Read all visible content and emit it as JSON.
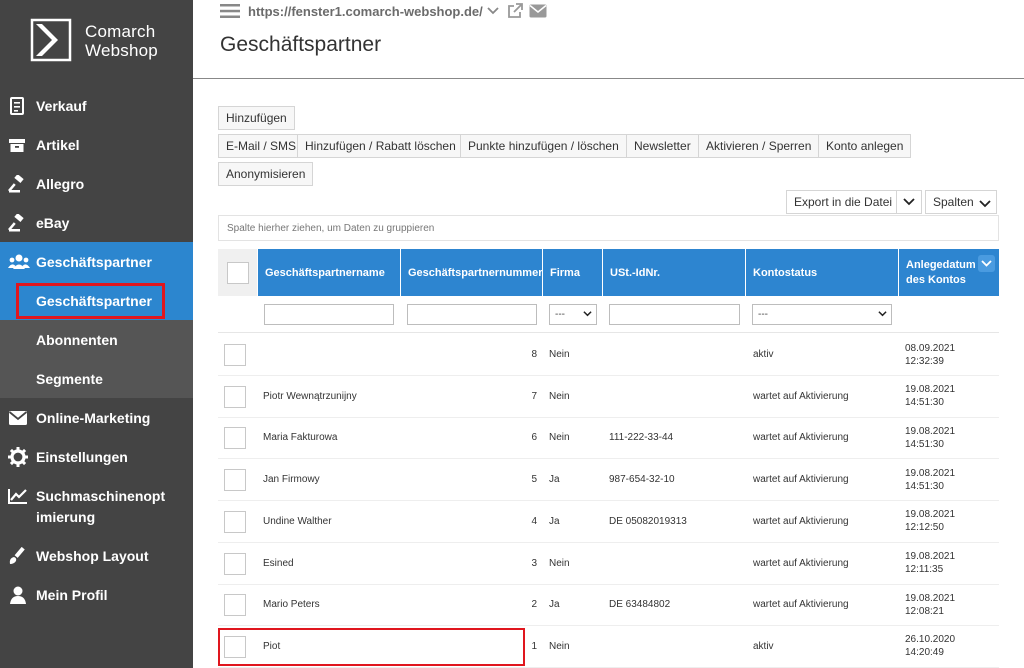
{
  "logo": {
    "line1": "Comarch",
    "line2": "Webshop"
  },
  "sidebar": {
    "items": [
      {
        "label": "Verkauf",
        "icon": "document-icon"
      },
      {
        "label": "Artikel",
        "icon": "box-icon"
      },
      {
        "label": "Allegro",
        "icon": "gavel-icon"
      },
      {
        "label": "eBay",
        "icon": "gavel-icon"
      },
      {
        "label": "Geschäftspartner",
        "icon": "users-icon"
      },
      {
        "label": "Online-Marketing",
        "icon": "envelope-icon"
      },
      {
        "label": "Einstellungen",
        "icon": "gear-icon"
      },
      {
        "label": "Suchmaschinenopt imierung",
        "line1": "Suchmaschinenopt",
        "line2": "imierung",
        "icon": "chart-icon"
      },
      {
        "label": "Webshop Layout",
        "icon": "brush-icon"
      },
      {
        "label": "Mein Profil",
        "icon": "user-icon"
      }
    ],
    "subitems": [
      {
        "label": "Geschäftspartner"
      },
      {
        "label": "Abonnenten"
      },
      {
        "label": "Segmente"
      }
    ]
  },
  "header": {
    "url": "https://fenster1.comarch-webshop.de/",
    "title": "Geschäftspartner"
  },
  "toolbar": {
    "add": "Hinzufügen",
    "email_sms": "E-Mail / SMS",
    "discount": "Hinzufügen / Rabatt löschen",
    "points": "Punkte hinzufügen / löschen",
    "newsletter": "Newsletter",
    "activate": "Aktivieren / Sperren",
    "account": "Konto anlegen",
    "anonymize": "Anonymisieren",
    "export": "Export in die Datei",
    "columns": "Spalten"
  },
  "grid": {
    "group_hint": "Spalte hierher ziehen, um Daten zu gruppieren",
    "headers": {
      "name": "Geschäftspartnername",
      "number": "Geschäftspartnernummer",
      "company": "Firma",
      "vat": "USt.-IdNr.",
      "status": "Kontostatus",
      "created_line1": "Anlegedatum",
      "created_line2": "des Kontos"
    },
    "filters": {
      "company_select": "---",
      "status_select": "---"
    },
    "rows": [
      {
        "name": "",
        "number": "8",
        "company": "Nein",
        "vat": "",
        "status": "aktiv",
        "date": "08.09.2021",
        "time": "12:32:39"
      },
      {
        "name": "Piotr Wewnątrzunijny",
        "number": "7",
        "company": "Nein",
        "vat": "",
        "status": "wartet auf Aktivierung",
        "date": "19.08.2021",
        "time": "14:51:30"
      },
      {
        "name": "Maria Fakturowa",
        "number": "6",
        "company": "Nein",
        "vat": "111-222-33-44",
        "status": "wartet auf Aktivierung",
        "date": "19.08.2021",
        "time": "14:51:30"
      },
      {
        "name": "Jan Firmowy",
        "number": "5",
        "company": "Ja",
        "vat": "987-654-32-10",
        "status": "wartet auf Aktivierung",
        "date": "19.08.2021",
        "time": "14:51:30"
      },
      {
        "name": "Undine Walther",
        "number": "4",
        "company": "Ja",
        "vat": "DE 05082019313",
        "status": "wartet auf Aktivierung",
        "date": "19.08.2021",
        "time": "12:12:50"
      },
      {
        "name": "Esined",
        "number": "3",
        "company": "Nein",
        "vat": "",
        "status": "wartet auf Aktivierung",
        "date": "19.08.2021",
        "time": "12:11:35"
      },
      {
        "name": "Mario Peters",
        "number": "2",
        "company": "Ja",
        "vat": "DE 63484802",
        "status": "wartet auf Aktivierung",
        "date": "19.08.2021",
        "time": "12:08:21"
      },
      {
        "name": "Piot",
        "number": "1",
        "company": "Nein",
        "vat": "",
        "status": "aktiv",
        "date": "26.10.2020",
        "time": "14:20:49"
      }
    ]
  },
  "colors": {
    "sidebar_bg": "#444444",
    "accent": "#2c86cf",
    "highlight": "#e0161e"
  }
}
